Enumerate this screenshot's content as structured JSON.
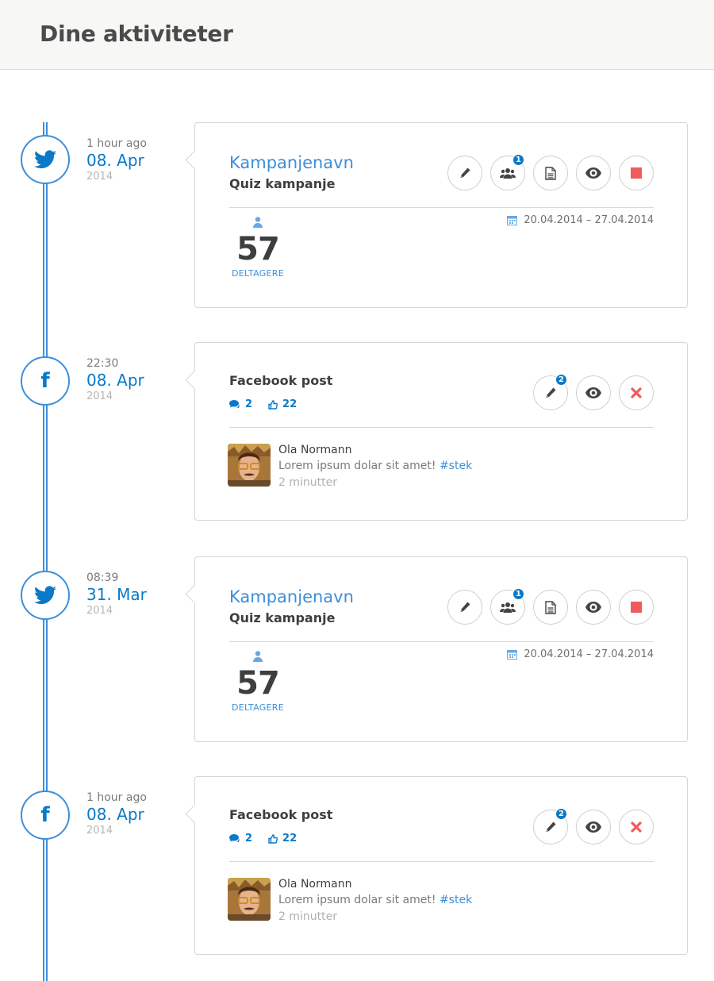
{
  "page": {
    "title": "Dine aktiviteter"
  },
  "colors": {
    "accent": "#0a79c8",
    "line": "#3d8fd8",
    "stop": "#f05a5a"
  },
  "entries": [
    {
      "kind": "campaign",
      "icon": "twitter-icon",
      "time": "1 hour ago",
      "date": "08. Apr",
      "year": "2014",
      "campaign_name": "Kampanjenavn",
      "campaign_type": "Quiz kampanje",
      "participants_count": "57",
      "participants_label": "DELTAGERE",
      "date_range": "20.04.2014 – 27.04.2014",
      "participants_badge": "1"
    },
    {
      "kind": "post",
      "icon": "facebook-icon",
      "time": "22:30",
      "date": "08. Apr",
      "year": "2014",
      "post_title": "Facebook post",
      "comments": "2",
      "likes": "22",
      "edit_badge": "2",
      "comment_author": "Ola Normann",
      "comment_text": "Lorem ipsum dolar sit amet!",
      "comment_tag": "#stek",
      "comment_time": "2 minutter"
    },
    {
      "kind": "campaign",
      "icon": "twitter-icon",
      "time": "08:39",
      "date": "31. Mar",
      "year": "2014",
      "campaign_name": "Kampanjenavn",
      "campaign_type": "Quiz kampanje",
      "participants_count": "57",
      "participants_label": "DELTAGERE",
      "date_range": "20.04.2014 – 27.04.2014",
      "participants_badge": "1"
    },
    {
      "kind": "post",
      "icon": "facebook-icon",
      "time": "1 hour ago",
      "date": "08. Apr",
      "year": "2014",
      "post_title": "Facebook post",
      "comments": "2",
      "likes": "22",
      "edit_badge": "2",
      "comment_author": "Ola Normann",
      "comment_text": "Lorem ipsum dolar sit amet!",
      "comment_tag": "#stek",
      "comment_time": "2 minutter"
    }
  ]
}
